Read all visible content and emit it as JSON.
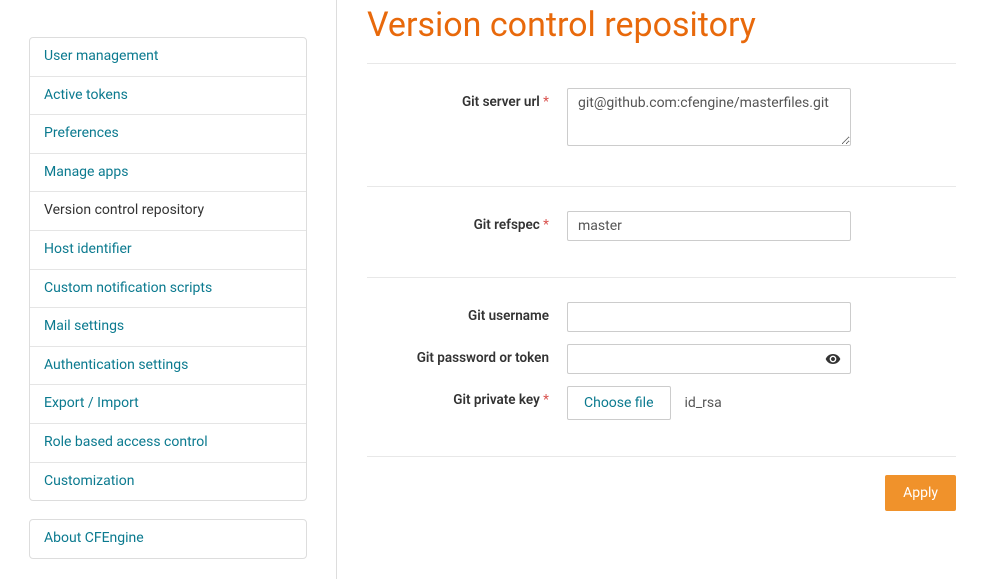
{
  "sidebar": {
    "items": [
      {
        "label": "User management",
        "active": false
      },
      {
        "label": "Active tokens",
        "active": false
      },
      {
        "label": "Preferences",
        "active": false
      },
      {
        "label": "Manage apps",
        "active": false
      },
      {
        "label": "Version control repository",
        "active": true
      },
      {
        "label": "Host identifier",
        "active": false
      },
      {
        "label": "Custom notification scripts",
        "active": false
      },
      {
        "label": "Mail settings",
        "active": false
      },
      {
        "label": "Authentication settings",
        "active": false
      },
      {
        "label": "Export / Import",
        "active": false
      },
      {
        "label": "Role based access control",
        "active": false
      },
      {
        "label": "Customization",
        "active": false
      }
    ],
    "about_label": "About CFEngine"
  },
  "page": {
    "title": "Version control repository"
  },
  "form": {
    "git_server_url": {
      "label": "Git server url",
      "required": "*",
      "value": "git@github.com:cfengine/masterfiles.git"
    },
    "git_refspec": {
      "label": "Git refspec",
      "required": "*",
      "value": "master"
    },
    "git_username": {
      "label": "Git username",
      "value": ""
    },
    "git_password": {
      "label": "Git password or token",
      "value": ""
    },
    "git_private_key": {
      "label": "Git private key",
      "required": "*",
      "button": "Choose file",
      "filename": "id_rsa"
    },
    "apply_label": "Apply"
  }
}
